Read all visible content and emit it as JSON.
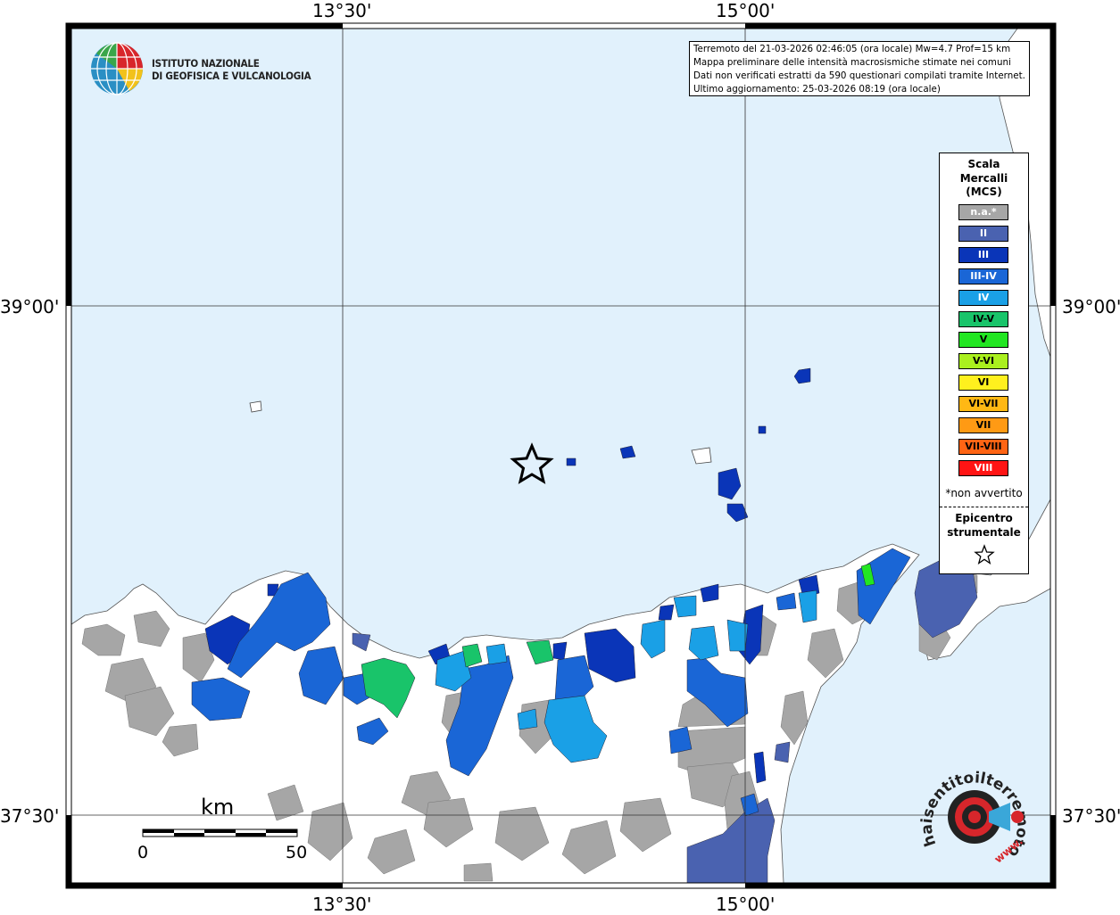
{
  "coord_labels": {
    "top": [
      "13°30'",
      "15°00'"
    ],
    "bottom": [
      "13°30'",
      "15°00'"
    ],
    "left": [
      "39°00'",
      "37°30'"
    ],
    "right": [
      "39°00'",
      "37°30'"
    ]
  },
  "info_box": {
    "lines": [
      "Terremoto del 21-03-2026 02:46:05 (ora locale) Mw=4.7 Prof=15 km",
      "Mappa preliminare delle intensità macrosismiche stimate nei comuni",
      "Dati non verificati estratti da 590 questionari compilati tramite Internet.",
      "Ultimo aggiornamento: 25-03-2026 08:19 (ora locale)"
    ]
  },
  "logo": {
    "line1": "ISTITUTO NAZIONALE",
    "line2": "DI GEOFISICA E VULCANOLOGIA"
  },
  "legend": {
    "title_lines": [
      "Scala",
      "Mercalli",
      "(MCS)"
    ],
    "items": [
      {
        "label": "n.a.*",
        "color": "#a6a6a6",
        "text_color": "#ffffff"
      },
      {
        "label": "II",
        "color": "#4a62b0",
        "text_color": "#ffffff"
      },
      {
        "label": "III",
        "color": "#0a35b8",
        "text_color": "#ffffff"
      },
      {
        "label": "III-IV",
        "color": "#1a66d6",
        "text_color": "#ffffff"
      },
      {
        "label": "IV",
        "color": "#1aa0e6",
        "text_color": "#ffffff"
      },
      {
        "label": "IV-V",
        "color": "#19c46a",
        "text_color": "#000000"
      },
      {
        "label": "V",
        "color": "#22e622",
        "text_color": "#000000"
      },
      {
        "label": "V-VI",
        "color": "#aaf01e",
        "text_color": "#000000"
      },
      {
        "label": "VI",
        "color": "#fff01e",
        "text_color": "#000000"
      },
      {
        "label": "VI-VII",
        "color": "#ffb814",
        "text_color": "#000000"
      },
      {
        "label": "VII",
        "color": "#ff9a14",
        "text_color": "#000000"
      },
      {
        "label": "VII-VIII",
        "color": "#ff6414",
        "text_color": "#000000"
      },
      {
        "label": "VIII",
        "color": "#ff1414",
        "text_color": "#ffffff"
      }
    ],
    "note": "*non avvertito",
    "epicenter_lines": [
      "Epicentro",
      "strumentale"
    ]
  },
  "scale_bar": {
    "unit": "km",
    "start": "0",
    "end": "50"
  },
  "watermark": {
    "text": "haisentitoilterremoto.it",
    "url_text": "www."
  },
  "colors": {
    "sea": "#e1f1fc",
    "land": "#ffffff",
    "not_available": "#a6a6a6",
    "intensity_II": "#4a62b0",
    "intensity_III": "#0a35b8",
    "intensity_III_IV": "#1a66d6",
    "intensity_IV": "#1aa0e6",
    "intensity_IV_V": "#19c46a",
    "intensity_V": "#22e622"
  }
}
